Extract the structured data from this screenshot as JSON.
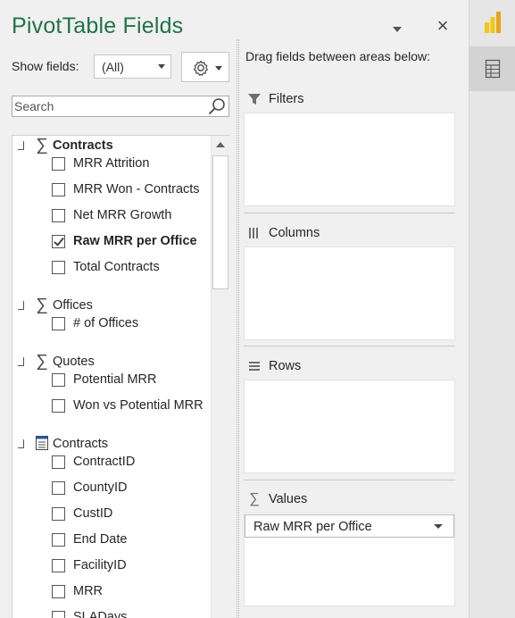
{
  "header": {
    "title": "PivotTable Fields",
    "close_glyph": "×"
  },
  "show_fields": {
    "label": "Show fields:",
    "selected": "(All)"
  },
  "search": {
    "placeholder": "Search"
  },
  "field_list": {
    "groups": [
      {
        "name": "Contracts",
        "icon": "sigma-icon",
        "bold": true,
        "fields": [
          {
            "label": "MRR Attrition",
            "checked": false
          },
          {
            "label": "MRR Won - Contracts",
            "checked": false
          },
          {
            "label": "Net MRR Growth",
            "checked": false
          },
          {
            "label": "Raw MRR per Office",
            "checked": true
          },
          {
            "label": "Total Contracts",
            "checked": false
          }
        ]
      },
      {
        "name": "Offices",
        "icon": "sigma-icon",
        "bold": false,
        "fields": [
          {
            "label": "# of Offices",
            "checked": false
          }
        ]
      },
      {
        "name": "Quotes",
        "icon": "sigma-icon",
        "bold": false,
        "fields": [
          {
            "label": "Potential MRR",
            "checked": false
          },
          {
            "label": "Won vs Potential MRR",
            "checked": false
          }
        ]
      },
      {
        "name": "Contracts",
        "icon": "table-icon",
        "bold": false,
        "fields": [
          {
            "label": "ContractID",
            "checked": false
          },
          {
            "label": "CountyID",
            "checked": false
          },
          {
            "label": "CustID",
            "checked": false
          },
          {
            "label": "End Date",
            "checked": false
          },
          {
            "label": "FacilityID",
            "checked": false
          },
          {
            "label": "MRR",
            "checked": false
          },
          {
            "label": "SLADays",
            "checked": false
          }
        ]
      }
    ]
  },
  "areas": {
    "hint": "Drag fields between areas below:",
    "filters": {
      "label": "Filters",
      "icon": "filter-icon"
    },
    "columns": {
      "label": "Columns",
      "icon": "columns-icon"
    },
    "rows": {
      "label": "Rows",
      "icon": "rows-icon"
    },
    "values": {
      "label": "Values",
      "icon": "sigma-icon",
      "items": [
        "Raw MRR per Office"
      ]
    }
  },
  "right_rail": {
    "buttons": [
      "power-bi-icon",
      "field-list-icon"
    ]
  },
  "colors": {
    "title": "#217346",
    "powerbi_yellow": "#f2c811",
    "powerbi_dark": "#e8a317"
  }
}
